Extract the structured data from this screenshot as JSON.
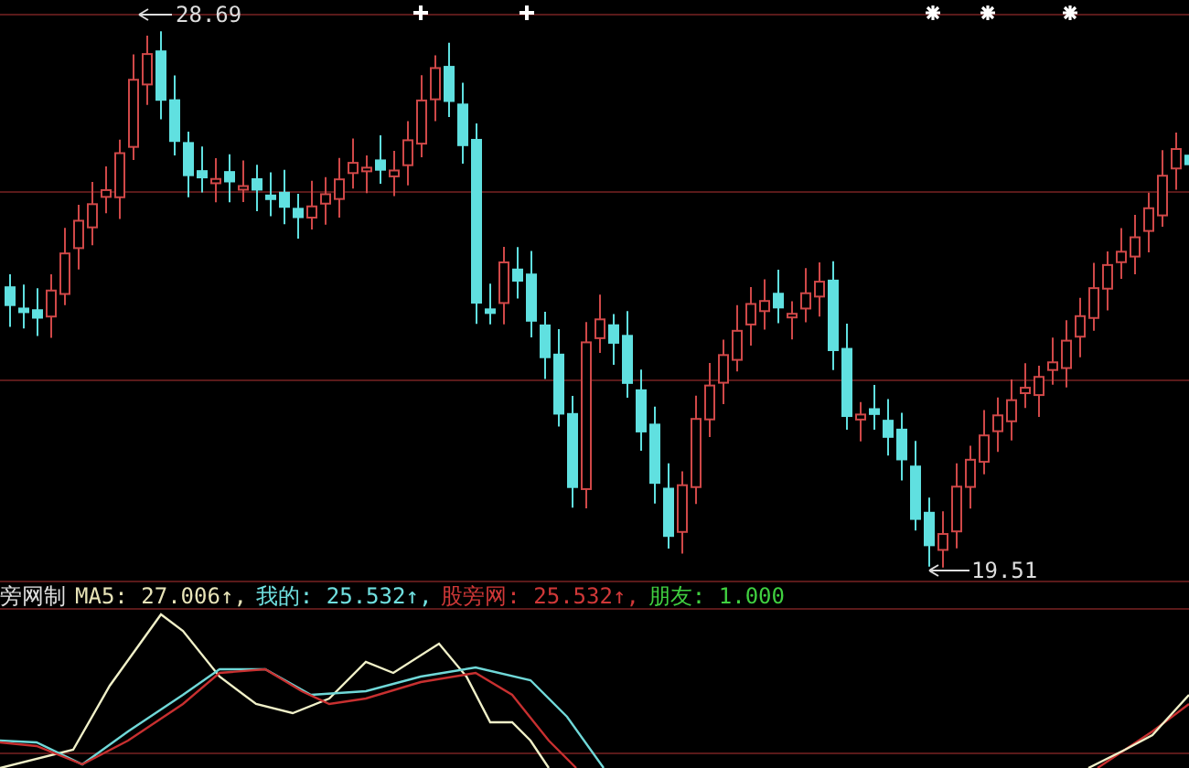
{
  "price_chart": {
    "high_label": "28.69",
    "low_label": "19.51"
  },
  "legend": {
    "title": "旁网制",
    "items": [
      {
        "text": "MA5: 27.006↑,",
        "color": "#e8e4b8"
      },
      {
        "text": "我的: 25.532↑,",
        "color": "#70e0e0"
      },
      {
        "text": "股旁网: 25.532↑,",
        "color": "#d03838"
      },
      {
        "text": "朋友: 1.000",
        "color": "#40d040"
      }
    ]
  }
}
